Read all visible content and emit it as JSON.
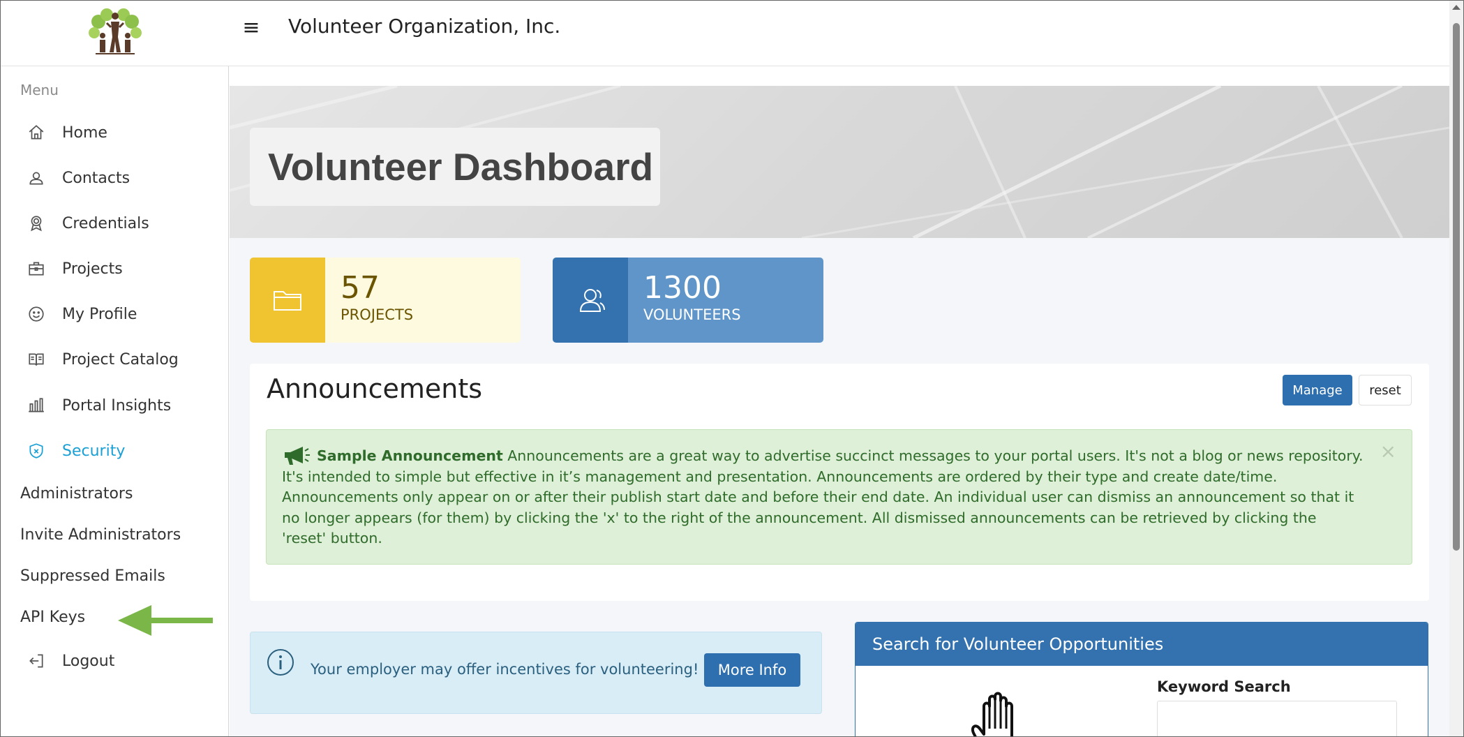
{
  "header": {
    "menu_icon": "hamburger-icon",
    "org_name": "Volunteer Organization, Inc."
  },
  "sidebar": {
    "caption": "Menu",
    "items": [
      {
        "label": "Home",
        "icon": "home-icon"
      },
      {
        "label": "Contacts",
        "icon": "contacts-icon"
      },
      {
        "label": "Credentials",
        "icon": "award-icon"
      },
      {
        "label": "Projects",
        "icon": "briefcase-icon"
      },
      {
        "label": "My Profile",
        "icon": "smiley-icon"
      },
      {
        "label": "Project Catalog",
        "icon": "book-icon"
      },
      {
        "label": "Portal Insights",
        "icon": "bar-chart-icon"
      },
      {
        "label": "Security",
        "icon": "shield-icon",
        "active": true
      }
    ],
    "security_subitems": [
      {
        "label": "Administrators"
      },
      {
        "label": "Invite Administrators"
      },
      {
        "label": "Suppressed Emails"
      },
      {
        "label": "API Keys"
      }
    ],
    "logout": {
      "label": "Logout",
      "icon": "logout-icon"
    },
    "annotation_arrow_color": "#7ab648"
  },
  "hero": {
    "title": "Volunteer Dashboard"
  },
  "stats": {
    "projects": {
      "value": "57",
      "label": "PROJECTS",
      "color": "#f0c330"
    },
    "volunteers": {
      "value": "1300",
      "label": "VOLUNTEERS",
      "color": "#3372ae"
    }
  },
  "announcements": {
    "title": "Announcements",
    "manage_label": "Manage",
    "reset_label": "reset",
    "item": {
      "heading": "Sample Announcement",
      "body": " Announcements are a great way to advertise succinct messages to your portal users. It's not a blog or news repository. It's intended to simple but effective in it’s management and presentation. Announcements are ordered by their type and create date/time. Announcements only appear on or after their publish start date and before their end date. An individual user can dismiss an announcement so that it no longer appears (for them) by clicking the 'x' to the right of the announcement. All dismissed announcements can be retrieved by clicking the 'reset' button.",
      "close": "×"
    }
  },
  "incentive": {
    "text": "Your employer may offer incentives for volunteering!",
    "button_label": "More Info"
  },
  "search": {
    "title": "Search for Volunteer Opportunities",
    "keyword_label": "Keyword Search",
    "keyword_value": ""
  }
}
